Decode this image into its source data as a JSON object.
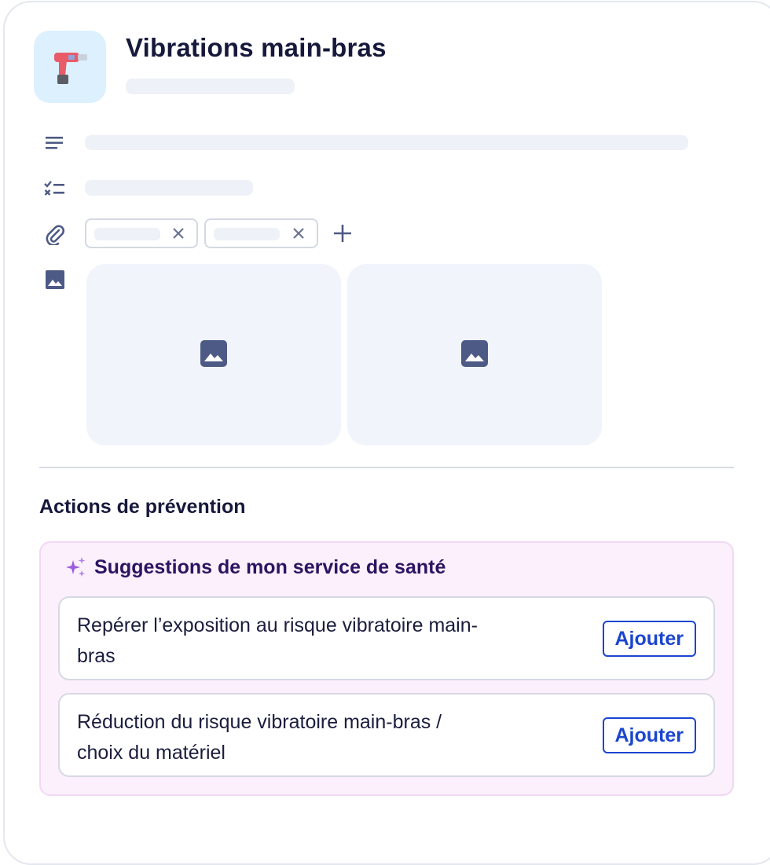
{
  "header": {
    "title": "Vibrations main-bras",
    "tool_icon": "heat-gun-icon"
  },
  "rows": {
    "description_icon": "lines-icon",
    "checklist_icon": "checklist-icon",
    "attachment_icon": "paperclip-icon",
    "image_icon": "image-icon"
  },
  "section": {
    "title": "Actions de prévention"
  },
  "suggestions": {
    "heading": "Suggestions de mon service de santé",
    "heading_icon": "sparkles-icon",
    "items": [
      {
        "label": "Repérer l’exposition au risque vibratoire main-bras",
        "button": "Ajouter"
      },
      {
        "label": "Réduction du risque vibratoire main-bras / choix du matériel",
        "button": "Ajouter"
      }
    ]
  },
  "colors": {
    "accent": "#1b45cf",
    "title": "#16193b",
    "suggest_bg": "#fbf0fc",
    "sparkle": "#9b5ce0"
  }
}
